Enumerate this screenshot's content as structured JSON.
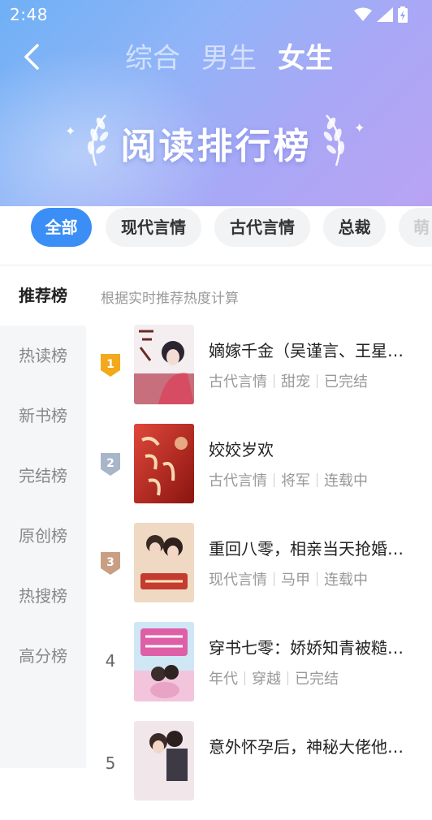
{
  "status_bar": {
    "time": "2:48",
    "icons": [
      "wifi-icon",
      "signal-icon",
      "battery-icon"
    ]
  },
  "header": {
    "tabs": [
      {
        "label": "综合",
        "active": false
      },
      {
        "label": "男生",
        "active": false
      },
      {
        "label": "女生",
        "active": true
      }
    ],
    "title": "阅读排行榜"
  },
  "categories": [
    {
      "label": "全部",
      "active": true
    },
    {
      "label": "现代言情",
      "active": false
    },
    {
      "label": "古代言情",
      "active": false
    },
    {
      "label": "总裁",
      "active": false
    },
    {
      "label": "萌",
      "active": false
    }
  ],
  "sidebar": {
    "items": [
      {
        "label": "推荐榜",
        "active": true
      },
      {
        "label": "热读榜",
        "active": false
      },
      {
        "label": "新书榜",
        "active": false
      },
      {
        "label": "完结榜",
        "active": false
      },
      {
        "label": "原创榜",
        "active": false
      },
      {
        "label": "热搜榜",
        "active": false
      },
      {
        "label": "高分榜",
        "active": false
      }
    ]
  },
  "list": {
    "hint": "根据实时推荐热度计算",
    "books": [
      {
        "rank": "1",
        "title": "嫡嫁千金（吴谨言、王星越主演）",
        "tags": [
          "古代言情",
          "甜宠",
          "已完结"
        ],
        "cover_color": "#c8a9b8"
      },
      {
        "rank": "2",
        "title": "姣姣岁欢",
        "tags": [
          "古代言情",
          "将军",
          "连载中"
        ],
        "cover_color": "#c8342c"
      },
      {
        "rank": "3",
        "title": "重回八零，相亲当天抢婚最野糙汉",
        "tags": [
          "现代言情",
          "马甲",
          "连载中"
        ],
        "cover_color": "#e8c7a9"
      },
      {
        "rank": "4",
        "title": "穿书七零：娇娇知青被糙汉宠上天",
        "tags": [
          "年代",
          "穿越",
          "已完结"
        ],
        "cover_color": "#d9b3d6"
      },
      {
        "rank": "5",
        "title": "意外怀孕后，神秘大佬他宠妻无度",
        "tags": [],
        "cover_color": "#e9dbe0"
      }
    ]
  },
  "colors": {
    "accent": "#3a8ef6",
    "gold": "#f2a91c",
    "silver": "#a9b5c8",
    "bronze": "#c89f82"
  }
}
